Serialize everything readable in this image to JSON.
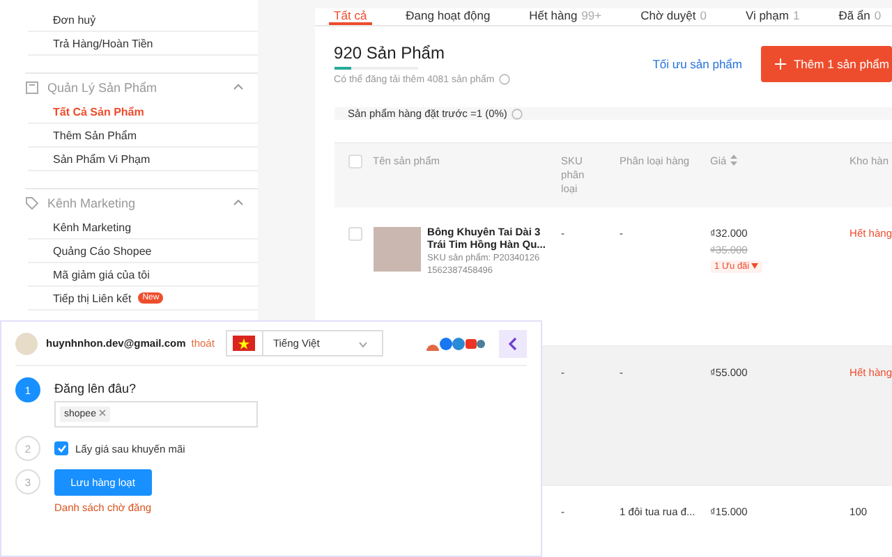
{
  "sidebar": {
    "sections": [
      {
        "items": [
          {
            "label": "Đơn huỷ",
            "selected": false
          },
          {
            "label": "Trả Hàng/Hoàn Tiền",
            "selected": false
          }
        ]
      },
      {
        "title": "Quản Lý Sản Phẩm",
        "kind": "box",
        "items": [
          {
            "label": "Tất Cả Sản Phẩm",
            "selected": true
          },
          {
            "label": "Thêm Sản Phẩm",
            "selected": false
          },
          {
            "label": "Sản Phẩm Vi Phạm",
            "selected": false
          }
        ]
      },
      {
        "title": "Kênh Marketing",
        "kind": "tag",
        "items": [
          {
            "label": "Kênh Marketing",
            "selected": false
          },
          {
            "label": "Quảng Cáo Shopee",
            "selected": false
          },
          {
            "label": "Mã giảm giá của tôi",
            "selected": false
          },
          {
            "label": "Tiếp thị Liên kết",
            "selected": false,
            "badge": "New"
          }
        ]
      }
    ]
  },
  "tabs": [
    {
      "label": "Tất cả",
      "selected": true
    },
    {
      "label": "Đang hoạt động",
      "selected": false
    },
    {
      "label": "Hết hàng",
      "count": "99+",
      "selected": false
    },
    {
      "label": "Chờ duyệt",
      "count": "0",
      "selected": false
    },
    {
      "label": "Vi phạm",
      "count": "1",
      "selected": false
    },
    {
      "label": "Đã ẩn",
      "count": "0",
      "selected": false
    }
  ],
  "summary": {
    "title": "920 Sản Phẩm",
    "level": 0.2,
    "hint": "Có thể đăng tải thêm 4081 sản phẩm",
    "optimize_link": "Tối ưu sản phẩm",
    "add_button": "Thêm 1 sản phẩm"
  },
  "notice": "Sản phẩm hàng đặt trước =1 (0%)",
  "table": {
    "all_checked": false,
    "columns": [
      "Tên sản phẩm",
      "SKU phân loại",
      "Phân loại hàng",
      "Giá",
      "Kho hàn"
    ],
    "rows": [
      {
        "highlighted": false,
        "checked": false,
        "name": "Bông Khuyên Tai Dài 3 Trái Tim Hồng Hàn Qu...",
        "sku_lines": [
          "SKU sản phẩm: P20340126",
          "1562387458496"
        ],
        "sku": "-",
        "variant": "-",
        "price": "₫32.000",
        "old_price": "₫35.000",
        "deal": "1 Ưu đãi",
        "stock": "Hết hàng",
        "out_of_stock": true
      },
      {
        "highlighted": true,
        "sku": "-",
        "variant": "-",
        "price": "₫55.000",
        "stock": "Hết hàng",
        "out_of_stock": true
      },
      {
        "highlighted": false,
        "sku": "-",
        "variant": "1 đôi tua rua đ...",
        "price": "₫15.000",
        "stock": "100",
        "out_of_stock": false
      }
    ]
  },
  "extension": {
    "email": "huynhnhon.dev@gmail.com",
    "logout": "thoát",
    "language": "Tiếng Việt",
    "steps": [
      {
        "number": "1",
        "active": true,
        "kind": "tags",
        "label": "Đăng lên đâu?",
        "tags": [
          "shopee"
        ]
      },
      {
        "number": "2",
        "active": false,
        "kind": "checkbox",
        "label": "Lấy giá sau khuyến mãi",
        "checked": true
      },
      {
        "number": "3",
        "active": false,
        "kind": "action",
        "button": "Lưu hàng loạt",
        "link": "Danh sách chờ đăng"
      }
    ]
  }
}
